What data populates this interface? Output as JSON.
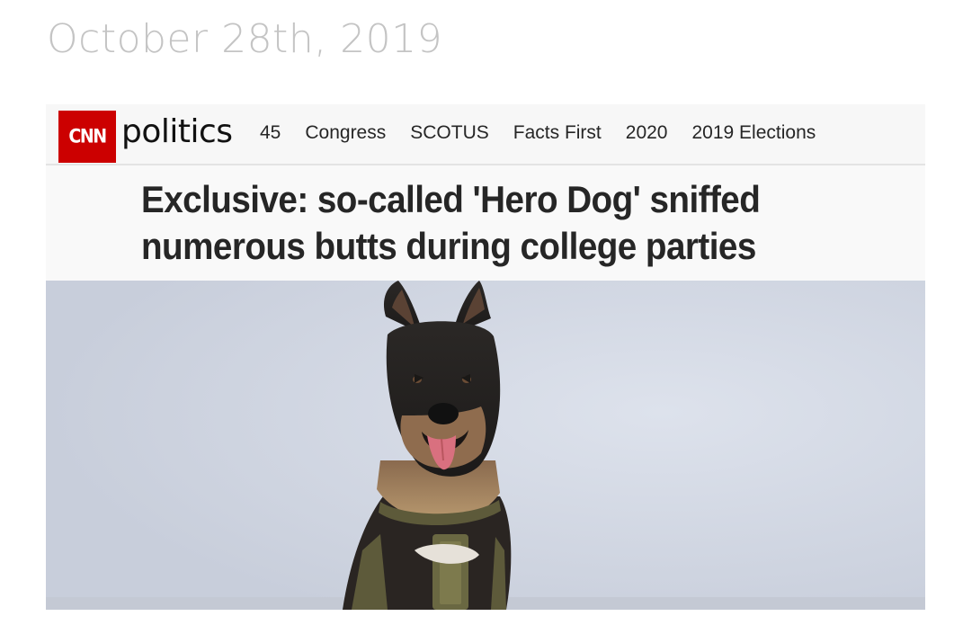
{
  "post": {
    "date": "October 28th, 2019"
  },
  "site": {
    "logo": "CNN",
    "section": "politics",
    "brand_color": "#cc0000",
    "nav_links": [
      {
        "label": "45"
      },
      {
        "label": "Congress"
      },
      {
        "label": "SCOTUS"
      },
      {
        "label": "Facts First"
      },
      {
        "label": "2020"
      },
      {
        "label": "2019 Elections"
      }
    ]
  },
  "article": {
    "headline_line1": "Exclusive: so-called 'Hero Dog' sniffed",
    "headline_line2": "numerous butts during college parties"
  },
  "photo": {
    "subject": "dog-photo",
    "background_color": "#d1d7e3"
  }
}
